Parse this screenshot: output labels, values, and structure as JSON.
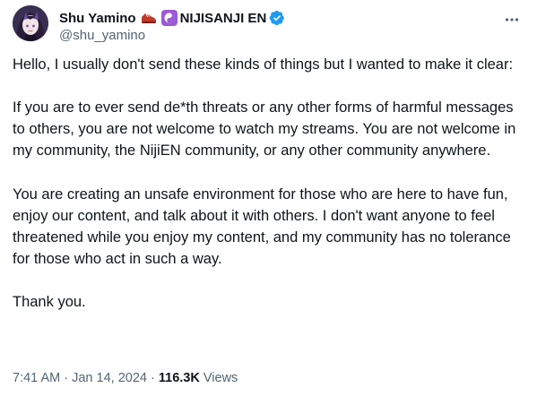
{
  "author": {
    "display_name": "Shu Yamino",
    "org_name": "NIJISANJI EN",
    "handle": "@shu_yamino",
    "avatar_icon": "avatar-portrait",
    "badges": [
      "shoe-emoji-icon",
      "yin-yang-emoji-icon",
      "verified-badge-icon"
    ]
  },
  "tweet": {
    "paragraphs": [
      "Hello, I usually don't send these kinds of things but I wanted to make it clear:",
      "If you are to ever send de*th threats or any other forms of harmful messages to others, you are not welcome to watch my streams. You are not welcome in my community, the NijiEN community, or any other community anywhere.",
      "You are creating an unsafe environment for those who are here to have fun, enjoy our content, and talk about it with others. I don't want anyone to feel threatened while you enjoy my content, and my community has no tolerance for those who act in such a way.",
      "Thank you."
    ],
    "time": "7:41 AM",
    "date": "Jan 14, 2024",
    "view_count": "116.3K",
    "views_label": "Views",
    "separator": "·"
  },
  "colors": {
    "text": "#0f1419",
    "secondary": "#536471",
    "verified": "#1d9bf0",
    "yin_yang_bg": "#9b59d6"
  }
}
